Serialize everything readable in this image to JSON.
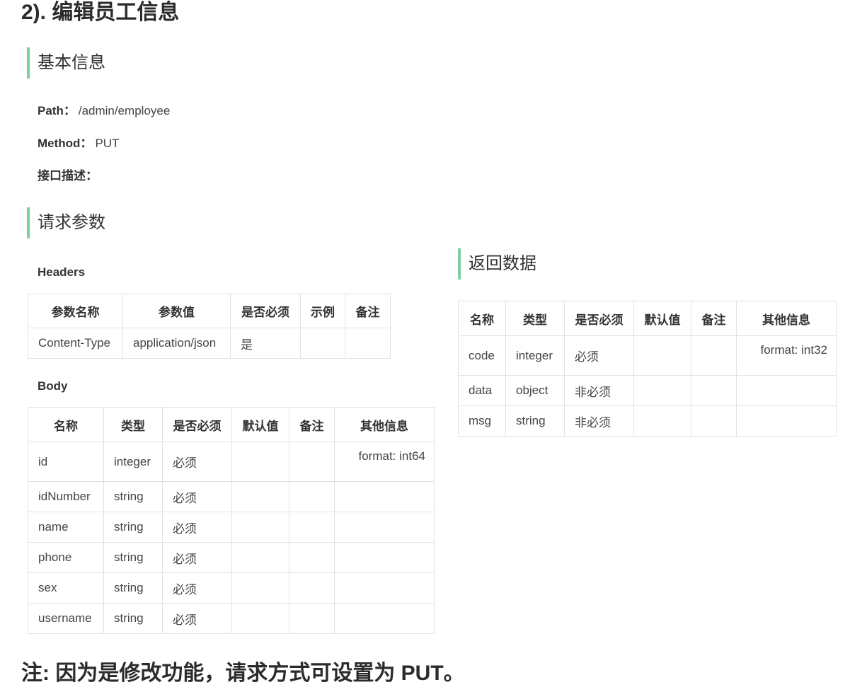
{
  "title": "2). 编辑员工信息",
  "basic": {
    "heading": "基本信息",
    "path_label": "Path：",
    "path_value": "/admin/employee",
    "method_label": "Method：",
    "method_value": "PUT",
    "desc_label": "接口描述："
  },
  "request": {
    "heading": "请求参数",
    "headers_label": "Headers",
    "headers_table": {
      "columns": [
        "参数名称",
        "参数值",
        "是否必须",
        "示例",
        "备注"
      ],
      "rows": [
        [
          "Content-Type",
          "application/json",
          "是",
          "",
          ""
        ]
      ]
    },
    "body_label": "Body",
    "body_table": {
      "columns": [
        "名称",
        "类型",
        "是否必须",
        "默认值",
        "备注",
        "其他信息"
      ],
      "rows": [
        [
          "id",
          "integer",
          "必须",
          "",
          "",
          "format: int64"
        ],
        [
          "idNumber",
          "string",
          "必须",
          "",
          "",
          ""
        ],
        [
          "name",
          "string",
          "必须",
          "",
          "",
          ""
        ],
        [
          "phone",
          "string",
          "必须",
          "",
          "",
          ""
        ],
        [
          "sex",
          "string",
          "必须",
          "",
          "",
          ""
        ],
        [
          "username",
          "string",
          "必须",
          "",
          "",
          ""
        ]
      ]
    }
  },
  "response": {
    "heading": "返回数据",
    "table": {
      "columns": [
        "名称",
        "类型",
        "是否必须",
        "默认值",
        "备注",
        "其他信息"
      ],
      "rows": [
        [
          "code",
          "integer",
          "必须",
          "",
          "",
          "format: int32"
        ],
        [
          "data",
          "object",
          "非必须",
          "",
          "",
          ""
        ],
        [
          "msg",
          "string",
          "非必须",
          "",
          "",
          ""
        ]
      ]
    }
  },
  "note": "注: 因为是修改功能，请求方式可设置为 PUT。",
  "colors": {
    "accent": "#7ccfa0",
    "border": "#dfe2e5"
  }
}
